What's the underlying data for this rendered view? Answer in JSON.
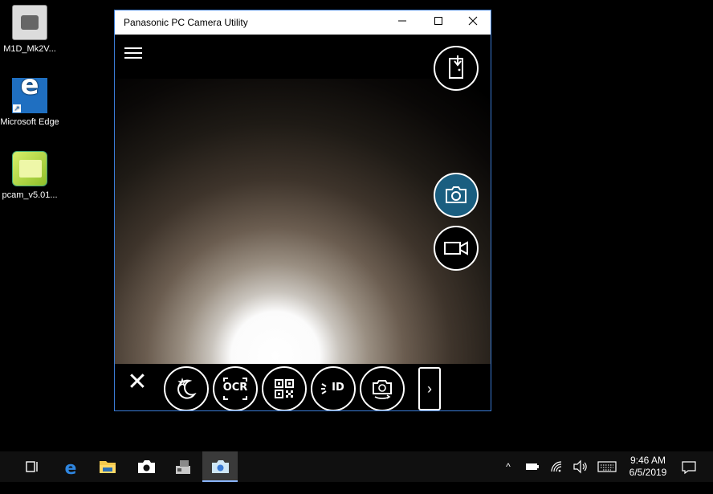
{
  "desktop": {
    "icons": [
      {
        "label": "M1D_Mk2V...",
        "icon": "camera-app-icon"
      },
      {
        "label": "Microsoft Edge",
        "icon": "edge-icon"
      },
      {
        "label": "pcam_v5.01...",
        "icon": "folder-icon"
      }
    ]
  },
  "window": {
    "title": "Panasonic PC Camera Utility",
    "controls": {
      "minimize": "—",
      "maximize": "☐",
      "close": "✕"
    }
  },
  "camera": {
    "menu_icon": "hamburger-menu-icon",
    "exit_icon": "exit-door-icon",
    "photo_icon": "camera-icon",
    "video_icon": "video-camera-icon",
    "photo_mode_color": "#1a5e80",
    "tools": {
      "close": "✕",
      "night_mode_icon": "moon-stars-icon",
      "ocr_label": "OCR",
      "qr_icon": "qr-code-icon",
      "id_label": "ID",
      "switch_camera_icon": "camera-switch-icon",
      "next": "›"
    }
  },
  "taskbar": {
    "items": [
      {
        "name": "task-view",
        "icon": "task-view-icon"
      },
      {
        "name": "edge",
        "icon": "edge-icon"
      },
      {
        "name": "file-explorer",
        "icon": "folder-icon"
      },
      {
        "name": "camera",
        "icon": "camera-icon"
      },
      {
        "name": "app",
        "icon": "stamp-icon"
      },
      {
        "name": "pc-camera-utility",
        "icon": "camera-icon",
        "active": true
      }
    ],
    "tray": {
      "chevron": "^",
      "time": "9:46 AM",
      "date": "6/5/2019"
    }
  }
}
